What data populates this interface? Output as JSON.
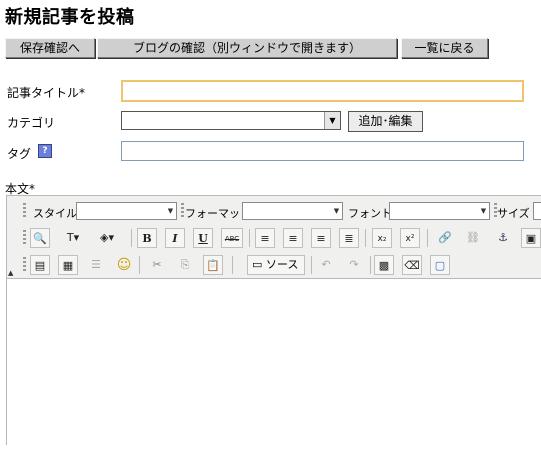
{
  "page": {
    "title": "新規記事を投稿"
  },
  "top_buttons": {
    "save_confirm": "保存確認へ",
    "blog_confirm": "ブログの確認（別ウィンドウで開きます）",
    "back_to_list": "一覧に戻る"
  },
  "form": {
    "title_label": "記事タイトル*",
    "title_value": "",
    "category_label": "カテゴリ",
    "category_value": "",
    "add_edit_label": "追加･編集",
    "tag_label": "タグ",
    "tag_help_icon": "?",
    "tag_value": "",
    "body_label": "本文*"
  },
  "toolbar": {
    "style_label": "スタイル",
    "format_label": "フォーマット",
    "font_label": "フォント",
    "size_label": "サイズ",
    "bold": "B",
    "italic": "I",
    "underline": "U",
    "strike": "ABC",
    "subscript": "x₂",
    "superscript": "x²",
    "source_label": "ソース"
  }
}
